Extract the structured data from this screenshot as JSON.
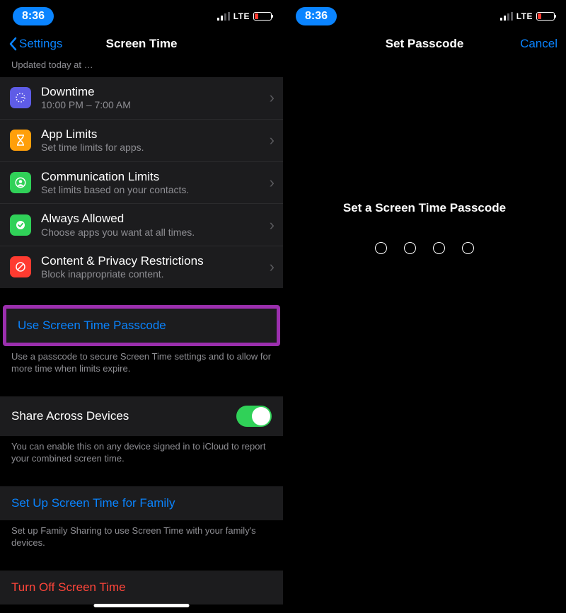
{
  "status": {
    "time": "8:36",
    "network": "LTE"
  },
  "left": {
    "back": "Settings",
    "title": "Screen Time",
    "truncated": "Updated today at …",
    "items": [
      {
        "title": "Downtime",
        "sub": "10:00 PM – 7:00 AM",
        "icon": "downtime",
        "bg": "#5e5ce6"
      },
      {
        "title": "App Limits",
        "sub": "Set time limits for apps.",
        "icon": "hourglass",
        "bg": "#ff9f0a"
      },
      {
        "title": "Communication Limits",
        "sub": "Set limits based on your contacts.",
        "icon": "contact",
        "bg": "#30d158"
      },
      {
        "title": "Always Allowed",
        "sub": "Choose apps you want at all times.",
        "icon": "check",
        "bg": "#30d158"
      },
      {
        "title": "Content & Privacy Restrictions",
        "sub": "Block inappropriate content.",
        "icon": "nosign",
        "bg": "#ff3b30"
      }
    ],
    "passcode_link": "Use Screen Time Passcode",
    "passcode_footer": "Use a passcode to secure Screen Time settings and to allow for more time when limits expire.",
    "share_label": "Share Across Devices",
    "share_footer": "You can enable this on any device signed in to iCloud to report your combined screen time.",
    "family_link": "Set Up Screen Time for Family",
    "family_footer": "Set up Family Sharing to use Screen Time with your family's devices.",
    "turn_off": "Turn Off Screen Time"
  },
  "right": {
    "title": "Set Passcode",
    "cancel": "Cancel",
    "prompt": "Set a Screen Time Passcode"
  }
}
